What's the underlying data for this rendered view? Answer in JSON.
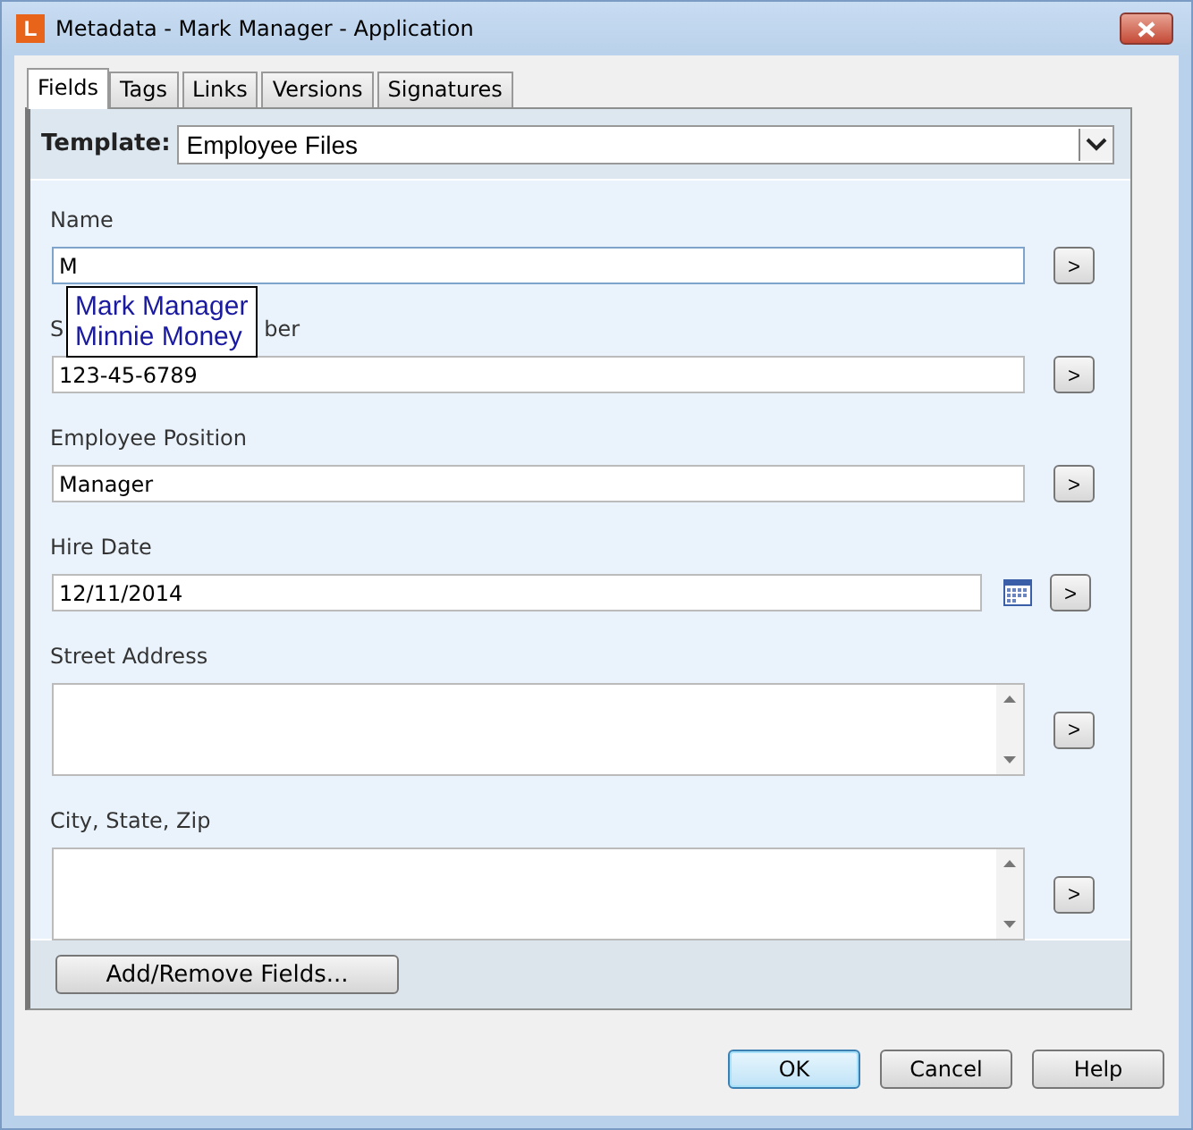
{
  "window": {
    "title": "Metadata - Mark Manager - Application",
    "icon_letter": "L"
  },
  "tabs": [
    {
      "label": "Fields",
      "selected": true
    },
    {
      "label": "Tags",
      "selected": false
    },
    {
      "label": "Links",
      "selected": false
    },
    {
      "label": "Versions",
      "selected": false
    },
    {
      "label": "Signatures",
      "selected": false
    }
  ],
  "template": {
    "label": "Template:",
    "value": "Employee Files"
  },
  "fields": [
    {
      "kind": "text",
      "label_parts": [
        "Name"
      ],
      "value": "M",
      "focused": true,
      "action": ">"
    },
    {
      "kind": "text",
      "label_parts": [
        "S",
        "ber"
      ],
      "value": "123-45-6789",
      "action": ">"
    },
    {
      "kind": "text",
      "label_parts": [
        "Employee Position"
      ],
      "value": "Manager",
      "action": ">"
    },
    {
      "kind": "date",
      "label_parts": [
        "Hire Date"
      ],
      "value": "12/11/2014",
      "action": ">"
    },
    {
      "kind": "multiline",
      "label_parts": [
        "Street Address"
      ],
      "action": ">"
    },
    {
      "kind": "multiline",
      "label_parts": [
        "City, State, Zip"
      ],
      "action": ">"
    }
  ],
  "autocomplete": [
    "Mark Manager",
    "Minnie Money"
  ],
  "add_remove_button": "Add/Remove Fields...",
  "buttons": [
    {
      "label": "OK",
      "default": true
    },
    {
      "label": "Cancel",
      "default": false
    },
    {
      "label": "Help",
      "default": false
    }
  ]
}
